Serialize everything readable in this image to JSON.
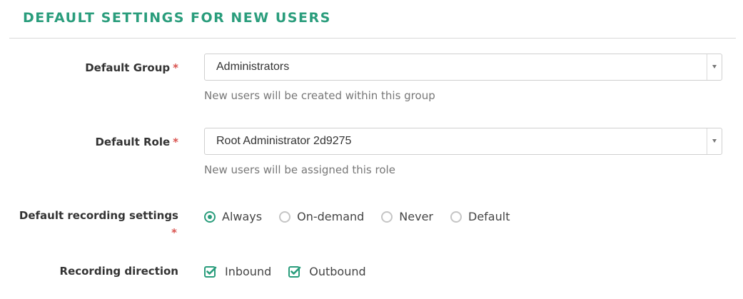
{
  "section": {
    "title": "DEFAULT SETTINGS FOR NEW USERS"
  },
  "colors": {
    "accent": "#2a9d7c",
    "required": "#d9534f",
    "help_text": "#777777"
  },
  "fields": {
    "default_group": {
      "label": "Default Group",
      "required_mark": "*",
      "value": "Administrators",
      "help": "New users will be created within this group"
    },
    "default_role": {
      "label": "Default Role",
      "required_mark": "*",
      "value": "Root Administrator 2d9275",
      "help": "New users will be assigned this role"
    },
    "recording_settings": {
      "label": "Default recording settings",
      "required_mark": "*",
      "options": [
        "Always",
        "On-demand",
        "Never",
        "Default"
      ],
      "selected": "Always"
    },
    "recording_direction": {
      "label": "Recording direction",
      "options": [
        "Inbound",
        "Outbound"
      ],
      "checked": [
        "Inbound",
        "Outbound"
      ]
    }
  }
}
